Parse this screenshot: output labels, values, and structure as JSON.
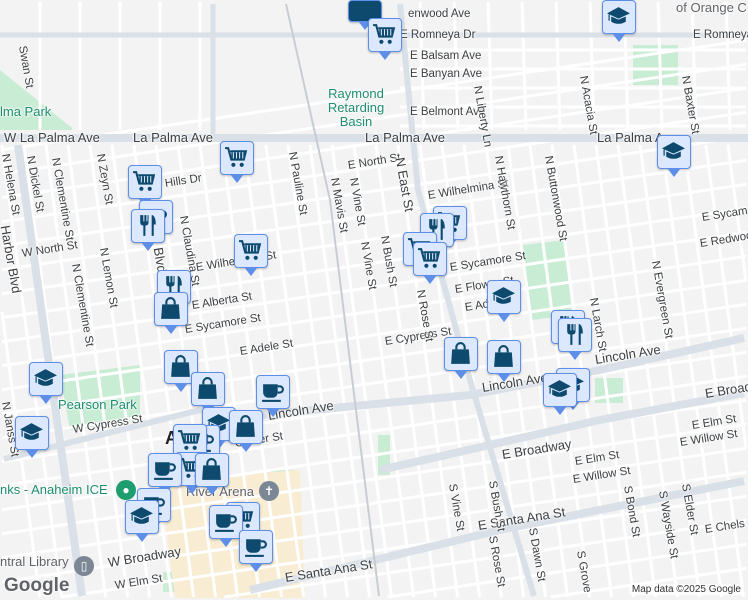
{
  "map": {
    "labels": [
      "enwood Ave",
      "E Romneya Dr",
      "E Romneya",
      "E Balsam Ave",
      "E Banyan Ave",
      "E Belmont Ave",
      "Raymond",
      "Retarding",
      "Basin",
      "W La Palma Ave",
      "La Palma Ave",
      "La Palma Ave",
      "La Palma A",
      "E North St",
      "E Wilhelmina St",
      "N East St",
      "N Hawthorn St",
      "N Buttonwood St",
      "N Liberty Ln",
      "N Acacia St",
      "N Baxter St",
      "E Sycam",
      "E Redwoo",
      "E Sycamore St",
      "E Flower St",
      "E Adel",
      "N Larch St",
      "N Evergreen St",
      "Lincoln Ave",
      "Lincoln Ave",
      "E Broad",
      "E Elm St",
      "E Willow St",
      "E Broadway",
      "E Elm St",
      "E Willow St",
      "E Santa Ana St",
      "E Chels",
      "S Vine St",
      "S Bush St",
      "S Rose St",
      "S Dawn St",
      "S Bond St",
      "S Wayside St",
      "S Elder St",
      "S Grove",
      "E Santa Ana St",
      "W Broadway",
      "W Elm St",
      "ntral Library",
      "nks - Anaheim ICE",
      "River Arena",
      "Pearson Park",
      "W Cypress St",
      "E Cypress St",
      "E Adele St",
      "E Sycamore St",
      "E Alberta St",
      "W North St",
      "lma Park",
      "Swan St",
      "N Helena St",
      "N Dickel St",
      "N Clementine St",
      "N Zeyn St",
      "N Lemon St",
      "N Clementine St",
      "Harbor Blvd",
      "N Pauline St",
      "N Mavis St",
      "N Vine St",
      "N Vine St",
      "N Bush St",
      "N Rose St",
      "Center St",
      "Lincoln Ave",
      "N Janss St",
      "A",
      "of Orange C",
      "E Wilhelmina St",
      "Hills Dr",
      "N Claudina St",
      "Blvd"
    ],
    "attribution": "Map data ©2025 Google",
    "logo": "Google",
    "colors": {
      "marker_bg": "#dce8fd",
      "marker_border": "#5e8fe8",
      "icon": "#0d4a6e",
      "park": "#c8ecd4",
      "park_text": "#1e8e6e"
    }
  }
}
